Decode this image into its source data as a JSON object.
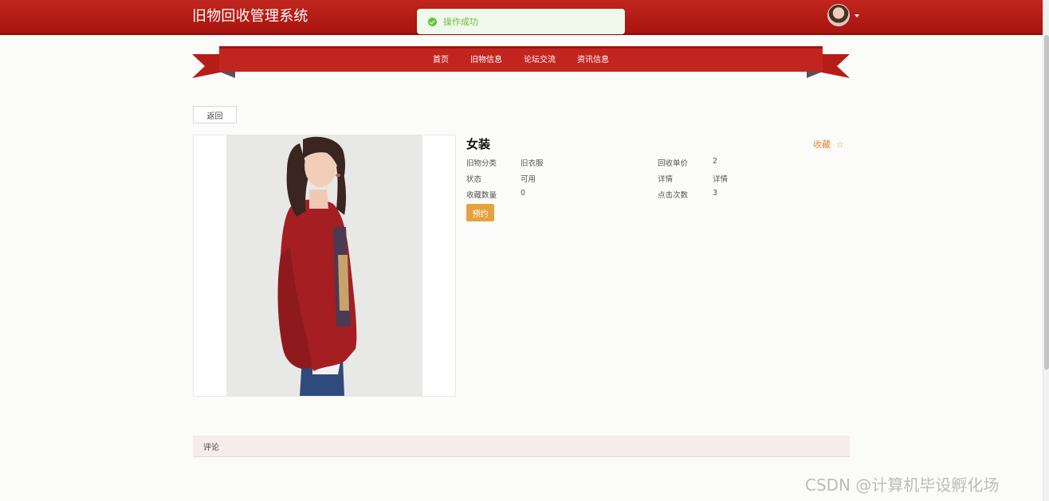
{
  "app": {
    "title": "旧物回收管理系统"
  },
  "toast": {
    "message": "操作成功",
    "icon": "check-circle-icon",
    "color": "#67c23a"
  },
  "user": {
    "avatar": "avatar-image",
    "menu_icon": "caret-down-icon"
  },
  "nav": {
    "items": [
      {
        "label": "首页"
      },
      {
        "label": "旧物信息"
      },
      {
        "label": "论坛交流"
      },
      {
        "label": "资讯信息"
      }
    ]
  },
  "actions": {
    "back_label": "返回",
    "reserve_label": "预约"
  },
  "product": {
    "name": "女装",
    "favorite_label": "收藏",
    "favorite_icon": "star-outline-icon",
    "fields": [
      {
        "label": "旧物分类",
        "value": "旧衣服"
      },
      {
        "label": "回收单价",
        "value": "2"
      },
      {
        "label": "状态",
        "value": "可用"
      },
      {
        "label": "详情",
        "value": "详情"
      },
      {
        "label": "收藏数量",
        "value": "0"
      },
      {
        "label": "点击次数",
        "value": "3"
      }
    ]
  },
  "comments": {
    "label": "评论"
  },
  "watermark": "CSDN @计算机毕设孵化场",
  "colors": {
    "header": "#b21a14",
    "banner": "#c0241e",
    "accent_orange": "#e6a23c",
    "success_green": "#67c23a"
  }
}
